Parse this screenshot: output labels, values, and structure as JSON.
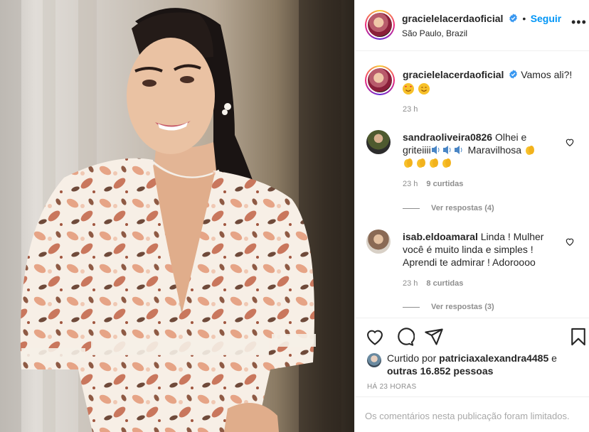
{
  "post": {
    "author": "gracielelacerdaoficial",
    "follow_label": "Seguir",
    "location": "São Paulo, Brazil",
    "more_label": "•••",
    "caption": "Vamos ali?!",
    "caption_time": "23 h"
  },
  "comments": [
    {
      "user": "sandraoliveira0826",
      "text_a": "Olhei e",
      "text_b": "griteiiii",
      "text_c": "Maravilhosa",
      "time": "23 h",
      "likes": "9 curtidas",
      "replies": "Ver respostas (4)"
    },
    {
      "user": "isab.eldoamaral",
      "text_a": "Linda ! Mulher",
      "text_b": "você é muito linda e simples !",
      "text_c": "Aprendi te admirar ! Adoroooo",
      "time": "23 h",
      "likes": "8 curtidas",
      "replies": "Ver respostas (3)"
    }
  ],
  "engagement": {
    "liked_by_prefix": "Curtido por",
    "liked_by_user": "patriciaxalexandra4485",
    "liked_by_join": "e",
    "others": "outras 16.852 pessoas",
    "timestamp": "HÁ 23 HORAS",
    "comments_limited": "Os comentários nesta publicação foram limitados."
  },
  "icons": {
    "verified": "verified-badge-icon",
    "like": "heart-icon",
    "comment": "comment-icon",
    "share": "paper-plane-icon",
    "save": "bookmark-icon"
  },
  "colors": {
    "follow": "#0095f6",
    "verified": "#3897f0",
    "muted": "#8e8e8e"
  }
}
